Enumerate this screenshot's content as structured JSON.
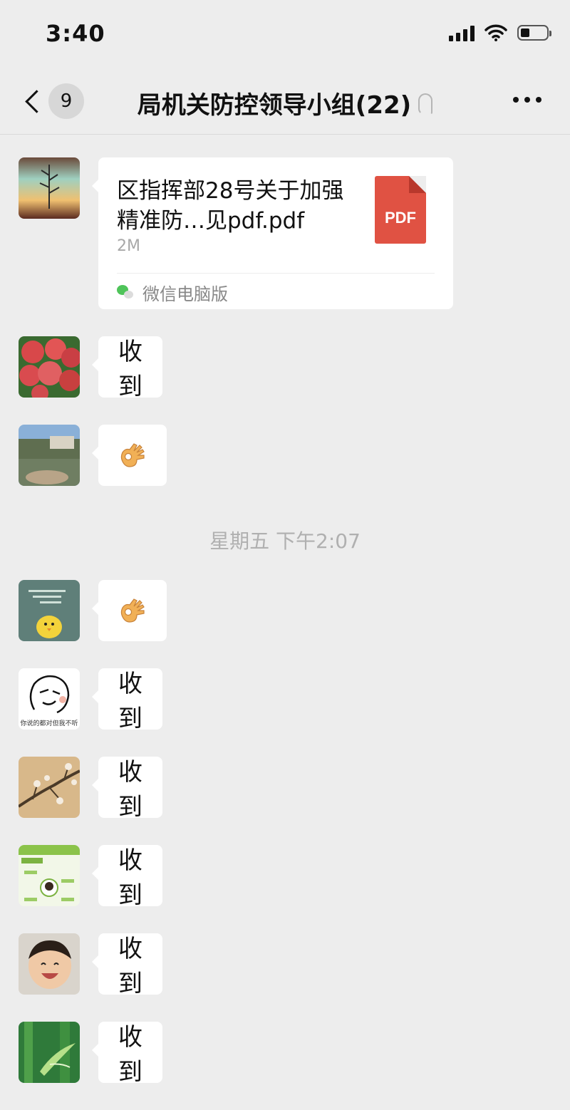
{
  "status_bar": {
    "time": "3:40",
    "battery_level": 0.35
  },
  "nav": {
    "unread_count": "9",
    "title": "局机关防控领导小组(22)"
  },
  "file_message": {
    "file_name": "区指挥部28号关于加强精准防…见pdf.pdf",
    "file_size": "2M",
    "file_type": "PDF",
    "source": "微信电脑版"
  },
  "messages": [
    {
      "text": "收到"
    },
    {
      "emoji": "ok-hand"
    },
    {
      "emoji": "ok-hand"
    },
    {
      "text": "收到"
    },
    {
      "text": "收到"
    },
    {
      "text": "收到"
    },
    {
      "text": "收到"
    },
    {
      "text": "收到"
    }
  ],
  "time_divider": "星期五 下午2:07",
  "avatar_caption": "你说的都对但我不听",
  "colors": {
    "background": "#ededed",
    "pdf": "#e05243",
    "wechat_green": "#4fc45a"
  }
}
